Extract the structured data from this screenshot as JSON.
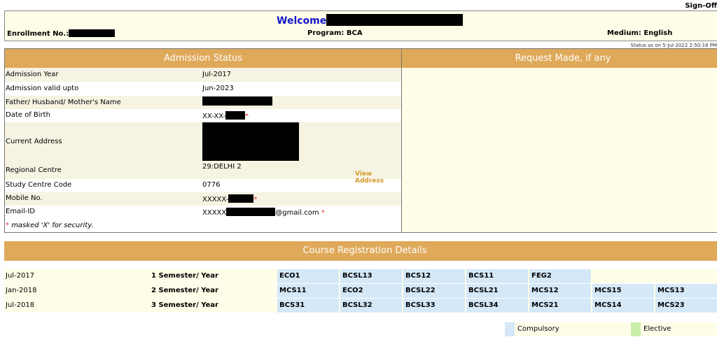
{
  "top": {
    "signoff_label": "Sign-Off",
    "welcome_label": "Welcome",
    "enrollment_label": "Enrollment No.:",
    "program_label": "Program: BCA",
    "medium_label": "Medium: English",
    "status_as_on": "Status as on 5-Jul-2022 2:50:18 PM"
  },
  "admission": {
    "title": "Admission Status",
    "rows": [
      {
        "label": "Admission Year",
        "value": "Jul-2017"
      },
      {
        "label": "Admission valid upto",
        "value": "Jun-2023"
      },
      {
        "label": "Father/ Husband/ Mother's Name",
        "value": ""
      },
      {
        "label": "Date of Birth",
        "value": "XX-XX-"
      },
      {
        "label": "Current Address",
        "value": ""
      },
      {
        "label": "Regional Centre",
        "value": "29:DELHI 2"
      },
      {
        "label": "Study Centre Code",
        "value": "0776"
      },
      {
        "label": "Mobile No.",
        "value": "XXXXX-"
      },
      {
        "label": "Email-ID",
        "value": "XXXXX",
        "suffix": "@gmail.com"
      }
    ],
    "view_address_label": "View Address",
    "star": "*",
    "mask_note": "masked 'X' for security."
  },
  "request": {
    "title": "Request Made, if any"
  },
  "course_registration": {
    "title": "Course Registration Details",
    "rows": [
      {
        "session": "Jul-2017",
        "semester": "1 Semester/ Year",
        "courses": [
          "ECO1",
          "BCSL13",
          "BCS12",
          "BCS11",
          "FEG2"
        ]
      },
      {
        "session": "Jan-2018",
        "semester": "2 Semester/ Year",
        "courses": [
          "MCS11",
          "ECO2",
          "BCSL22",
          "BCSL21",
          "MCS12",
          "MCS15",
          "MCS13"
        ]
      },
      {
        "session": "Jul-2018",
        "semester": "3 Semester/ Year",
        "courses": [
          "BCS31",
          "BCSL32",
          "BCSL33",
          "BCSL34",
          "MCS21",
          "MCS14",
          "MCS23"
        ]
      }
    ]
  },
  "legend": {
    "compulsory_label": "Compulsory",
    "elective_label": "Elective",
    "compulsory_color": "#d4e8f8",
    "elective_color": "#c8f0a8"
  }
}
